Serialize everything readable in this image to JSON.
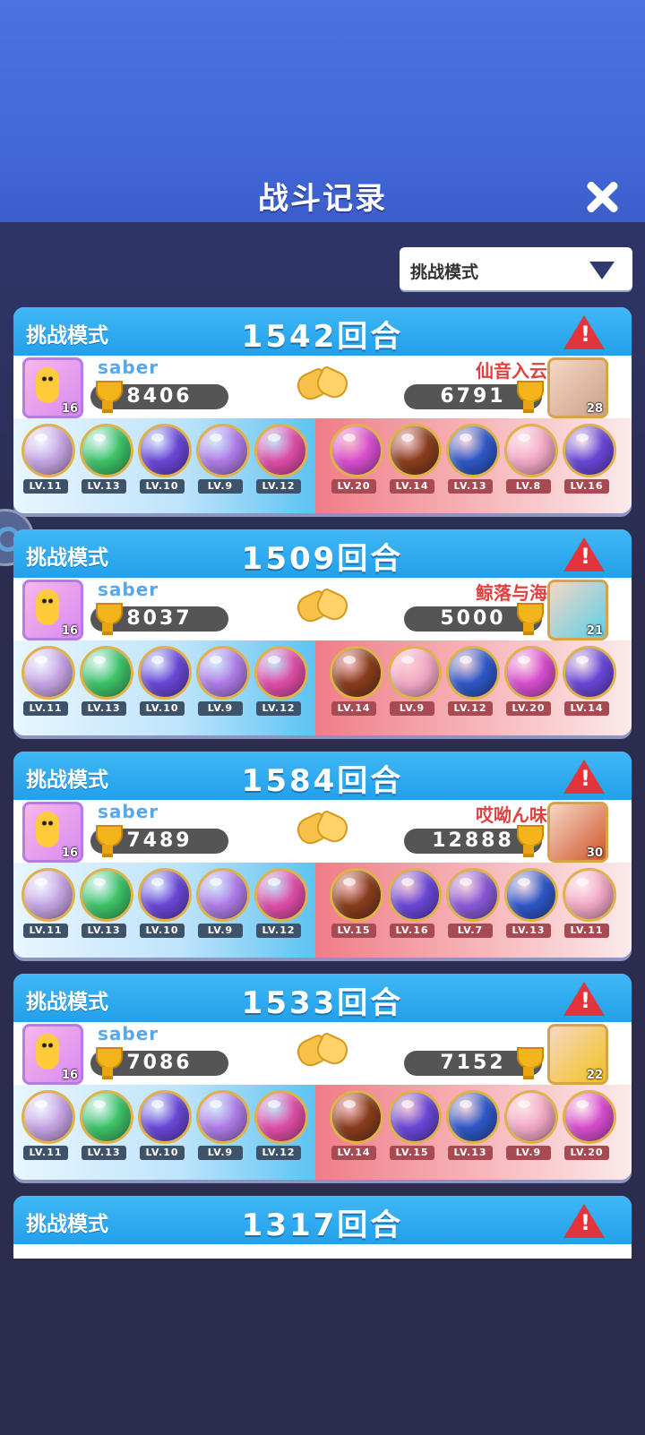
{
  "header": {
    "title": "战斗记录"
  },
  "filter": {
    "selected": "挑战模式"
  },
  "records": [
    {
      "mode": "挑战模式",
      "rounds": "1542回合",
      "me": {
        "name": "saber",
        "score": "8406",
        "level": "16",
        "skills": [
          {
            "lv": "LV.11",
            "color": "#c9a6e6"
          },
          {
            "lv": "LV.13",
            "color": "#3fc46a"
          },
          {
            "lv": "LV.10",
            "color": "#6a48d8"
          },
          {
            "lv": "LV.9",
            "color": "#b07de8"
          },
          {
            "lv": "LV.12",
            "color": "#e04fa8"
          }
        ]
      },
      "opponent": {
        "name": "仙音入云",
        "score": "6791",
        "level": "28",
        "avatar_color": "#caa08a",
        "skills": [
          {
            "lv": "LV.20",
            "color": "#d94fd0"
          },
          {
            "lv": "LV.14",
            "color": "#8a3e1e"
          },
          {
            "lv": "LV.13",
            "color": "#2f58c8"
          },
          {
            "lv": "LV.8",
            "color": "#f3a9c7"
          },
          {
            "lv": "LV.16",
            "color": "#6a48d8"
          }
        ]
      }
    },
    {
      "mode": "挑战模式",
      "rounds": "1509回合",
      "me": {
        "name": "saber",
        "score": "8037",
        "level": "16",
        "skills": [
          {
            "lv": "LV.11",
            "color": "#c9a6e6"
          },
          {
            "lv": "LV.13",
            "color": "#3fc46a"
          },
          {
            "lv": "LV.10",
            "color": "#6a48d8"
          },
          {
            "lv": "LV.9",
            "color": "#b07de8"
          },
          {
            "lv": "LV.12",
            "color": "#e04fa8"
          }
        ]
      },
      "opponent": {
        "name": "鲸落与海",
        "score": "5000",
        "level": "21",
        "avatar_color": "#5ad0e6",
        "skills": [
          {
            "lv": "LV.14",
            "color": "#8a3e1e"
          },
          {
            "lv": "LV.9",
            "color": "#f3a9c7"
          },
          {
            "lv": "LV.12",
            "color": "#2f58c8"
          },
          {
            "lv": "LV.20",
            "color": "#d94fd0"
          },
          {
            "lv": "LV.14",
            "color": "#6a48d8"
          }
        ]
      }
    },
    {
      "mode": "挑战模式",
      "rounds": "1584回合",
      "me": {
        "name": "saber",
        "score": "7489",
        "level": "16",
        "skills": [
          {
            "lv": "LV.11",
            "color": "#c9a6e6"
          },
          {
            "lv": "LV.13",
            "color": "#3fc46a"
          },
          {
            "lv": "LV.10",
            "color": "#6a48d8"
          },
          {
            "lv": "LV.9",
            "color": "#b07de8"
          },
          {
            "lv": "LV.12",
            "color": "#e04fa8"
          }
        ]
      },
      "opponent": {
        "name": "哎呦ん味",
        "score": "12888",
        "level": "30",
        "avatar_color": "#d0562a",
        "skills": [
          {
            "lv": "LV.15",
            "color": "#8a3e1e"
          },
          {
            "lv": "LV.16",
            "color": "#6a48d8"
          },
          {
            "lv": "LV.7",
            "color": "#8a5ad8"
          },
          {
            "lv": "LV.13",
            "color": "#2f58c8"
          },
          {
            "lv": "LV.11",
            "color": "#f3a9c7"
          }
        ]
      }
    },
    {
      "mode": "挑战模式",
      "rounds": "1533回合",
      "me": {
        "name": "saber",
        "score": "7086",
        "level": "16",
        "skills": [
          {
            "lv": "LV.11",
            "color": "#c9a6e6"
          },
          {
            "lv": "LV.13",
            "color": "#3fc46a"
          },
          {
            "lv": "LV.10",
            "color": "#6a48d8"
          },
          {
            "lv": "LV.9",
            "color": "#b07de8"
          },
          {
            "lv": "LV.12",
            "color": "#e04fa8"
          }
        ]
      },
      "opponent": {
        "name": "",
        "score": "7152",
        "level": "22",
        "avatar_color": "#f2c21a",
        "skills": [
          {
            "lv": "LV.14",
            "color": "#8a3e1e"
          },
          {
            "lv": "LV.15",
            "color": "#6a48d8"
          },
          {
            "lv": "LV.13",
            "color": "#2f58c8"
          },
          {
            "lv": "LV.9",
            "color": "#f3a9c7"
          },
          {
            "lv": "LV.20",
            "color": "#d94fd0"
          }
        ]
      }
    },
    {
      "mode": "挑战模式",
      "rounds": "1317回合"
    }
  ]
}
